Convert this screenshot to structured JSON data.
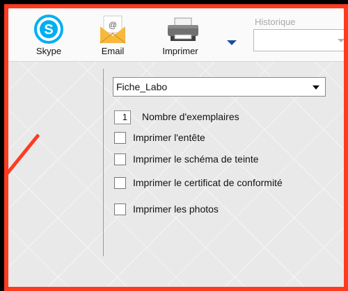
{
  "toolbar": {
    "skype_label": "Skype",
    "email_label": "Email",
    "print_label": "Imprimer",
    "email_icon_symbol": "@",
    "history_label": "Historique",
    "history_value": ""
  },
  "form": {
    "model_value": "Fiche_Labo",
    "copies_value": "1",
    "copies_label": "Nombre d'exemplaires",
    "options": [
      {
        "label": "Imprimer l'entête",
        "checked": false
      },
      {
        "label": "Imprimer le schéma de teinte",
        "checked": false
      },
      {
        "label": "Imprimer le certificat de conformité",
        "checked": false
      },
      {
        "label": "Imprimer les photos",
        "checked": false
      }
    ]
  },
  "colors": {
    "frame_border": "#ff3b1f",
    "skype_blue": "#00aff0",
    "envelope_yellow": "#f4b93e",
    "dropdown_arrow": "#1a4f9e"
  },
  "icons": [
    "skype-icon",
    "email-icon",
    "printer-icon",
    "dropdown-arrow-icon"
  ]
}
